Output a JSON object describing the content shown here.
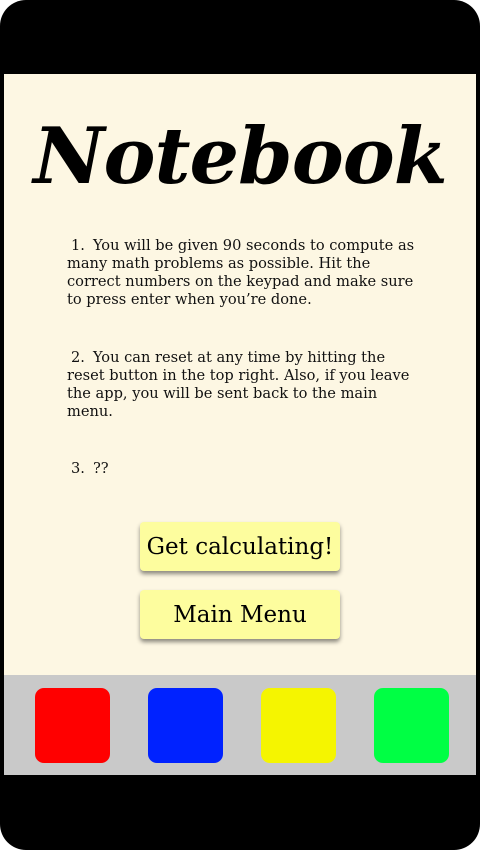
{
  "app": {
    "title": "Notebook"
  },
  "instructions": [
    {
      "number": "1.",
      "text": "You will be given 90 seconds to compute as many math problems as possible. Hit the correct numbers on the keypad and make sure to press enter when you’re done."
    },
    {
      "number": "2.",
      "text": "You can reset at any time by hitting the reset button in the top right. Also, if you leave the app, you will be sent back to the main menu."
    },
    {
      "number": "3.",
      "text": "??"
    }
  ],
  "buttons": {
    "start_label": "Get calculating!",
    "menu_label": "Main Menu",
    "color": "#fdfd9e"
  },
  "color_keys": [
    {
      "name": "red",
      "color": "#ff0000"
    },
    {
      "name": "blue",
      "color": "#0022ff"
    },
    {
      "name": "yellow",
      "color": "#f5f500"
    },
    {
      "name": "green",
      "color": "#00ff44"
    }
  ],
  "colors": {
    "screen_background": "#fdf7e3",
    "device_frame": "#000000",
    "keybar_background": "#c9c9c9"
  }
}
